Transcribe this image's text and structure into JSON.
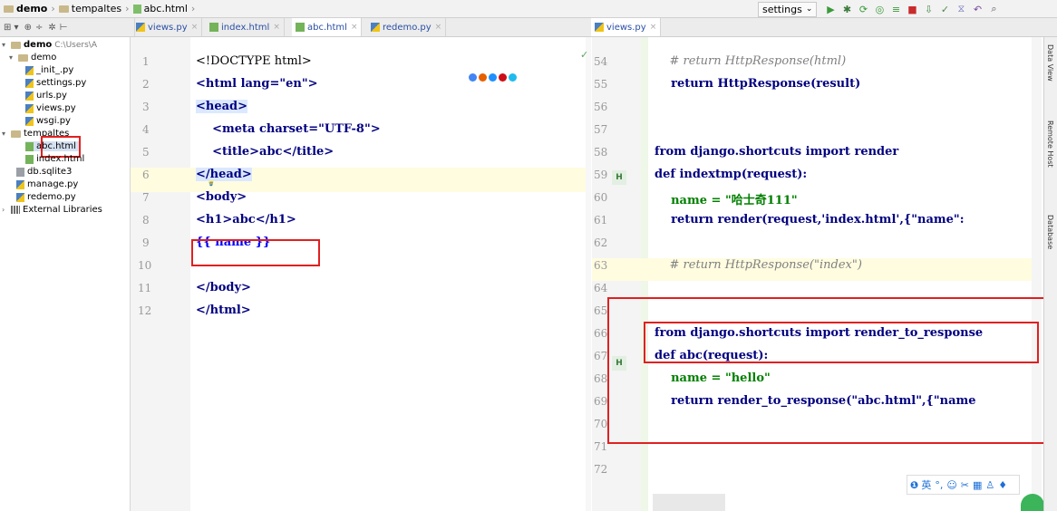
{
  "breadcrumb": [
    "demo",
    "tempaltes",
    "abc.html"
  ],
  "run_config": "settings",
  "editor_tabs_left": [
    {
      "label": "views.py",
      "type": "py"
    },
    {
      "label": "index.html",
      "type": "html"
    },
    {
      "label": "abc.html",
      "type": "html",
      "active": true
    },
    {
      "label": "redemo.py",
      "type": "py"
    }
  ],
  "editor_tabs_right": [
    {
      "label": "views.py",
      "type": "py",
      "active": true
    }
  ],
  "project_tree": {
    "root_label": "demo",
    "root_path": "C:\\Users\\A",
    "items": [
      {
        "label": "demo",
        "depth": 1,
        "kind": "folder",
        "expanded": true
      },
      {
        "label": "_init_.py",
        "depth": 2,
        "kind": "py"
      },
      {
        "label": "settings.py",
        "depth": 2,
        "kind": "py"
      },
      {
        "label": "urls.py",
        "depth": 2,
        "kind": "py"
      },
      {
        "label": "views.py",
        "depth": 2,
        "kind": "py"
      },
      {
        "label": "wsgi.py",
        "depth": 2,
        "kind": "py"
      },
      {
        "label": "tempaltes",
        "depth": 1,
        "kind": "folder",
        "expanded": true
      },
      {
        "label": "abc.html",
        "depth": 2,
        "kind": "html",
        "selected": true
      },
      {
        "label": "index.html",
        "depth": 2,
        "kind": "html"
      },
      {
        "label": "db.sqlite3",
        "depth": 1,
        "kind": "db"
      },
      {
        "label": "manage.py",
        "depth": 1,
        "kind": "py"
      },
      {
        "label": "redemo.py",
        "depth": 1,
        "kind": "py"
      },
      {
        "label": "External Libraries",
        "depth": 0,
        "kind": "lib"
      }
    ]
  },
  "left_editor": {
    "lines": [
      {
        "n": "1",
        "text": "<!DOCTYPE html>"
      },
      {
        "n": "2",
        "text": "<html lang=\"en\">"
      },
      {
        "n": "3",
        "text": "<head>"
      },
      {
        "n": "4",
        "text": "    <meta charset=\"UTF-8\">"
      },
      {
        "n": "5",
        "text": "    <title>abc</title>"
      },
      {
        "n": "6",
        "text": "</head>"
      },
      {
        "n": "7",
        "text": "<body>"
      },
      {
        "n": "8",
        "text": "<h1>abc</h1>"
      },
      {
        "n": "9",
        "text": "{{ name }}"
      },
      {
        "n": "10",
        "text": ""
      },
      {
        "n": "11",
        "text": "</body>"
      },
      {
        "n": "12",
        "text": "</html>"
      }
    ]
  },
  "right_editor": {
    "lines": [
      {
        "n": "54",
        "text": "    # return HttpResponse(html)"
      },
      {
        "n": "55",
        "text": "    return HttpResponse(result)"
      },
      {
        "n": "56",
        "text": ""
      },
      {
        "n": "57",
        "text": ""
      },
      {
        "n": "58",
        "text": "from django.shortcuts import render"
      },
      {
        "n": "59",
        "text": "def indextmp(request):"
      },
      {
        "n": "60",
        "text": "    name = \"哈士奇111\""
      },
      {
        "n": "61",
        "text": "    return render(request,'index.html',{\"name\":"
      },
      {
        "n": "62",
        "text": ""
      },
      {
        "n": "63",
        "text": "    # return HttpResponse(\"index\")"
      },
      {
        "n": "64",
        "text": ""
      },
      {
        "n": "65",
        "text": ""
      },
      {
        "n": "66",
        "text": "from django.shortcuts import render_to_response"
      },
      {
        "n": "67",
        "text": "def abc(request):"
      },
      {
        "n": "68",
        "text": "    name = \"hello\""
      },
      {
        "n": "69",
        "text": "    return render_to_response(\"abc.html\",{\"name"
      },
      {
        "n": "70",
        "text": ""
      },
      {
        "n": "71",
        "text": ""
      },
      {
        "n": "72",
        "text": ""
      }
    ]
  },
  "side_panels": [
    "Data View",
    "Remote Host",
    "Database"
  ],
  "colors": {
    "keyword": "#000080",
    "string": "#008000",
    "comment": "#808080",
    "highlight_box": "#e02020",
    "current_line": "#fffce0"
  }
}
